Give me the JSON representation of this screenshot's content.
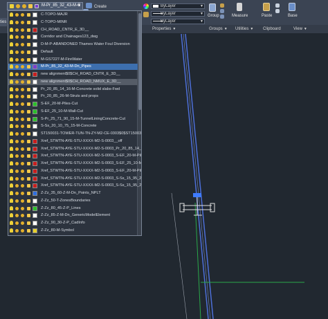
{
  "ribbon": {
    "left_tab_label": "ties",
    "create_label": "Create",
    "layer_current": "M-Pr_85_32_43-M-C",
    "properties": {
      "color_value": "ByLayer",
      "linetype_value": "ByLayer",
      "lineweight_value": "ByLayer"
    },
    "buttons": {
      "group": "Group",
      "measure": "Measure",
      "paste": "Paste",
      "base": "Base"
    },
    "panels": {
      "properties": "Properties",
      "groups": "Groups",
      "utilities": "Utilities",
      "clipboard": "Clipboard",
      "view": "View"
    }
  },
  "layers": [
    {
      "name": "C-TOPO-MAJR",
      "color": "#ffffff",
      "state": "normal"
    },
    {
      "name": "C-TOPO-MINR",
      "color": "#ffffff",
      "state": "normal"
    },
    {
      "name": "CH_ROAD_CNTR_E_3D__",
      "color": "#c81e1e",
      "state": "normal"
    },
    {
      "name": "Corridor and Chainages123_dwg",
      "color": "#ffffff",
      "state": "normal"
    },
    {
      "name": "D-M-P-ABANDONED Thames Water Foul Diversion",
      "color": "#ffffff",
      "state": "normal"
    },
    {
      "name": "Default",
      "color": "#ffffff",
      "state": "normal"
    },
    {
      "name": "M-GS7227-M-FireWater",
      "color": "#ffffff",
      "state": "normal"
    },
    {
      "name": "M-Pr_85_32_43-M-Dn_Pipes",
      "color": "#7a3fd1",
      "state": "active"
    },
    {
      "name": "new alignment$0$CH_ROAD_CNTR_E_3D__",
      "color": "#c81e1e",
      "state": "normal"
    },
    {
      "name": "new alignment$0$CH_ROAD_NMUX_E_3D__",
      "color": "#ffffff",
      "state": "hover"
    },
    {
      "name": "Pr_20_85_14_16-M-Concrete solid slabs-Fwd",
      "color": "#ffffff",
      "state": "normal"
    },
    {
      "name": "Pr_20_85_26-M-Struts and props",
      "color": "#ffffff",
      "state": "normal"
    },
    {
      "name": "S-EF_20-M-Piles-Cut",
      "color": "#2bbf2b",
      "state": "normal"
    },
    {
      "name": "S-EF_25_10-M-Wall-Cut",
      "color": "#2bbf2b",
      "state": "normal"
    },
    {
      "name": "S-Pr_25_71_90_15-M-TunnelLiningConcrete-Cut",
      "color": "#2bbf2b",
      "state": "normal"
    },
    {
      "name": "S-Ss_20_10_75_15-M-Concrete",
      "color": "#ffffff",
      "state": "normal"
    },
    {
      "name": "ST150031-TOWER-TUN-TN-ZY-M2-CE-0303$0$ST150031-TOW...",
      "color": "#ffffff",
      "state": "normal"
    },
    {
      "name": "Xref_STWTN-AYE-STU-XXXX-M2-S-0003__off",
      "color": "#c81e1e",
      "state": "normal"
    },
    {
      "name": "Xref_STWTN-AYE-STU-XXXX-M2-S-0003_Pr_20_85_14_16-M-Con...",
      "color": "#c81e1e",
      "state": "normal"
    },
    {
      "name": "Xref_STWTN-AYE-STU-XXXX-M2-S-0003_S-EF_20-M-Piles-Cut",
      "color": "#c81e1e",
      "state": "normal"
    },
    {
      "name": "Xref_STWTN-AYE-STU-XXXX-M2-S-0003_S-EF_25_10-M-Wall-Cut",
      "color": "#c81e1e",
      "state": "normal"
    },
    {
      "name": "Xref_STWTN-AYE-STU-XXXX-M2-S-0003_S-EF_20-M-Piles-Hid",
      "color": "#c81e1e",
      "state": "normal"
    },
    {
      "name": "Xref_STWTN-AYE-STU-XXXX-M2-S-0003_S-Ss_15_95_20_32-Fre...",
      "color": "#c81e1e",
      "state": "normal"
    },
    {
      "name": "Xref_STWTN-AYE-STU-XXXX-M2-S-0003_S-Ss_15_95_20_32-Fre...",
      "color": "#c81e1e",
      "state": "normal"
    },
    {
      "name": "Z-Zz_35_60-Z-M-Dn_Points_NPLT",
      "color": "#2f6fe0",
      "state": "normal"
    },
    {
      "name": "Z-Zz_50-T-ZonesBoundaries",
      "color": "#ffffff",
      "state": "normal"
    },
    {
      "name": "Z-Zz_80_45-Z-P_Lines",
      "color": "#2bbf2b",
      "state": "normal"
    },
    {
      "name": "Z-Zz_85-Z-M-Dn_GenericModelElement",
      "color": "#ffffff",
      "state": "normal"
    },
    {
      "name": "Z-Zz_90_30-Z-P_CadInfo",
      "color": "#ffffff",
      "state": "normal"
    },
    {
      "name": "Z-Zz_80-M-Symbol",
      "color": "#e8d22a",
      "state": "normal"
    }
  ]
}
